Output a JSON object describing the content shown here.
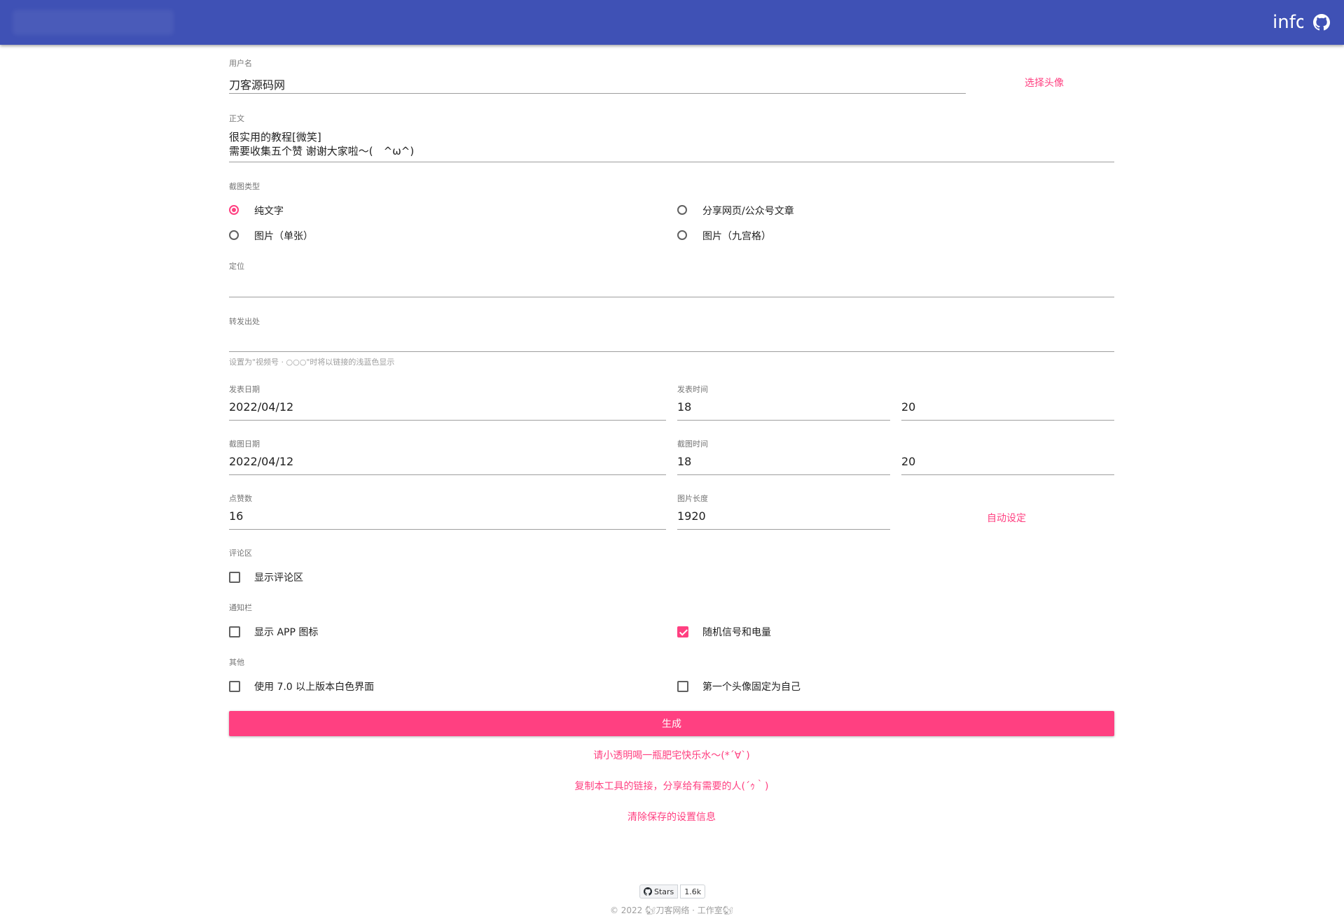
{
  "appbar": {
    "info_label": "info"
  },
  "form": {
    "username": {
      "label": "用户名",
      "value": "刀客源码网",
      "avatar_button": "选择头像"
    },
    "body": {
      "label": "正文",
      "line1": "很实用的教程[微笑]",
      "line2": "需要收集五个赞 谢谢大家啦～(　^ω^)"
    },
    "screenshot_type": {
      "label": "截图类型",
      "options": [
        "纯文字",
        "分享网页/公众号文章",
        "图片（单张）",
        "图片（九宫格）"
      ],
      "selected": "纯文字"
    },
    "location": {
      "label": "定位",
      "value": ""
    },
    "forward": {
      "label": "转发出处",
      "value": "",
      "helper": "设置为\"视频号 · ○○○\"时将以链接的浅蓝色显示"
    },
    "post_date": {
      "label": "发表日期",
      "value": "2022/04/12"
    },
    "post_time": {
      "label": "发表时间",
      "hour": "18",
      "minute": "20"
    },
    "shot_date": {
      "label": "截图日期",
      "value": "2022/04/12"
    },
    "shot_time": {
      "label": "截图时间",
      "hour": "18",
      "minute": "20"
    },
    "likes": {
      "label": "点赞数",
      "value": "16"
    },
    "image_length": {
      "label": "图片长度",
      "value": "1920",
      "auto_button": "自动设定"
    },
    "comments": {
      "label": "评论区",
      "show_comments": "显示评论区",
      "checked": false
    },
    "notification": {
      "label": "通知栏",
      "show_app_icon": "显示 APP 图标",
      "show_app_icon_checked": false,
      "random_signal": "随机信号和电量",
      "random_signal_checked": true
    },
    "other": {
      "label": "其他",
      "white_ui": "使用 7.0 以上版本白色界面",
      "white_ui_checked": false,
      "fix_avatar": "第一个头像固定为自己",
      "fix_avatar_checked": false
    },
    "generate_button": "生成"
  },
  "links": {
    "donate": "请小透明喝一瓶肥宅快乐水～(*´∀`)",
    "share": "复制本工具的链接，分享给有需要的人(´ｩ｀)",
    "clear": "清除保存的设置信息"
  },
  "footer": {
    "stars_label": "Stars",
    "stars_count": "1.6k",
    "copyright": "© 2022 🐿刀客网络 · 工作室🐿"
  },
  "colors": {
    "primary": "#3f51b5",
    "accent": "#ff4081"
  }
}
